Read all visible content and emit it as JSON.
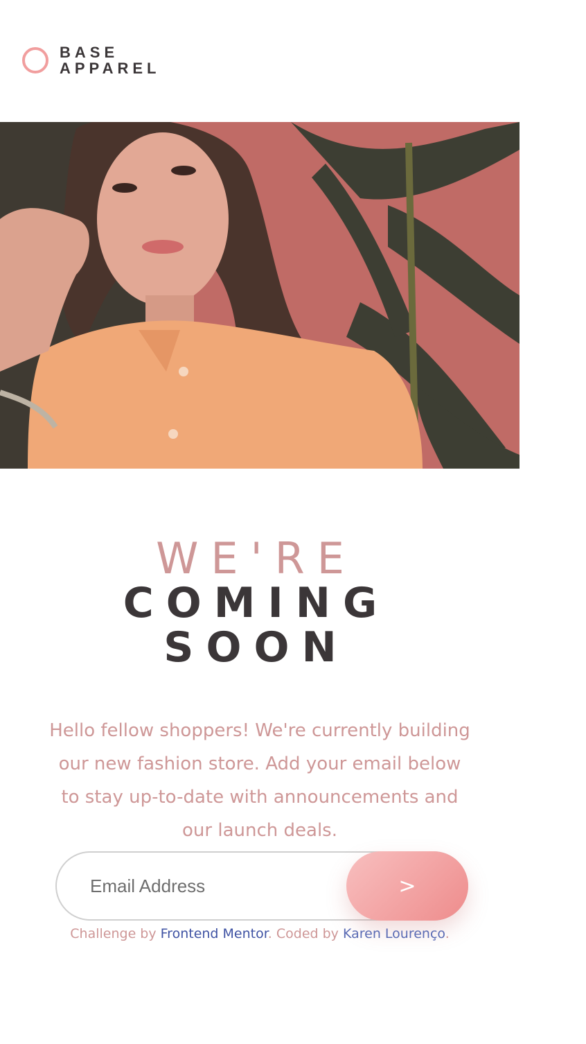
{
  "logo": {
    "line1": "BASE",
    "line2": "APPAREL",
    "accent_color": "#f19e9e"
  },
  "hero": {
    "image_icon": "portrait-photo"
  },
  "headline": {
    "line1": "WE'RE",
    "line2": "COMING",
    "line3": "SOON"
  },
  "intro": {
    "text": "Hello fellow shoppers! We're currently building our new fashion store. Add your email below to stay up-to-date with announcements and our launch deals."
  },
  "form": {
    "email_placeholder": "Email Address",
    "submit_label": ">"
  },
  "footer": {
    "prefix": "Challenge by ",
    "link1": "Frontend Mentor",
    "middle": ". Coded by ",
    "link2": "Karen Lourenço",
    "suffix": "."
  },
  "colors": {
    "desaturated_red": "#ce9797",
    "dark_grayish_red": "#3b3638",
    "button_gradient_start": "#f8bfbf",
    "button_gradient_end": "#ee8c8c"
  }
}
